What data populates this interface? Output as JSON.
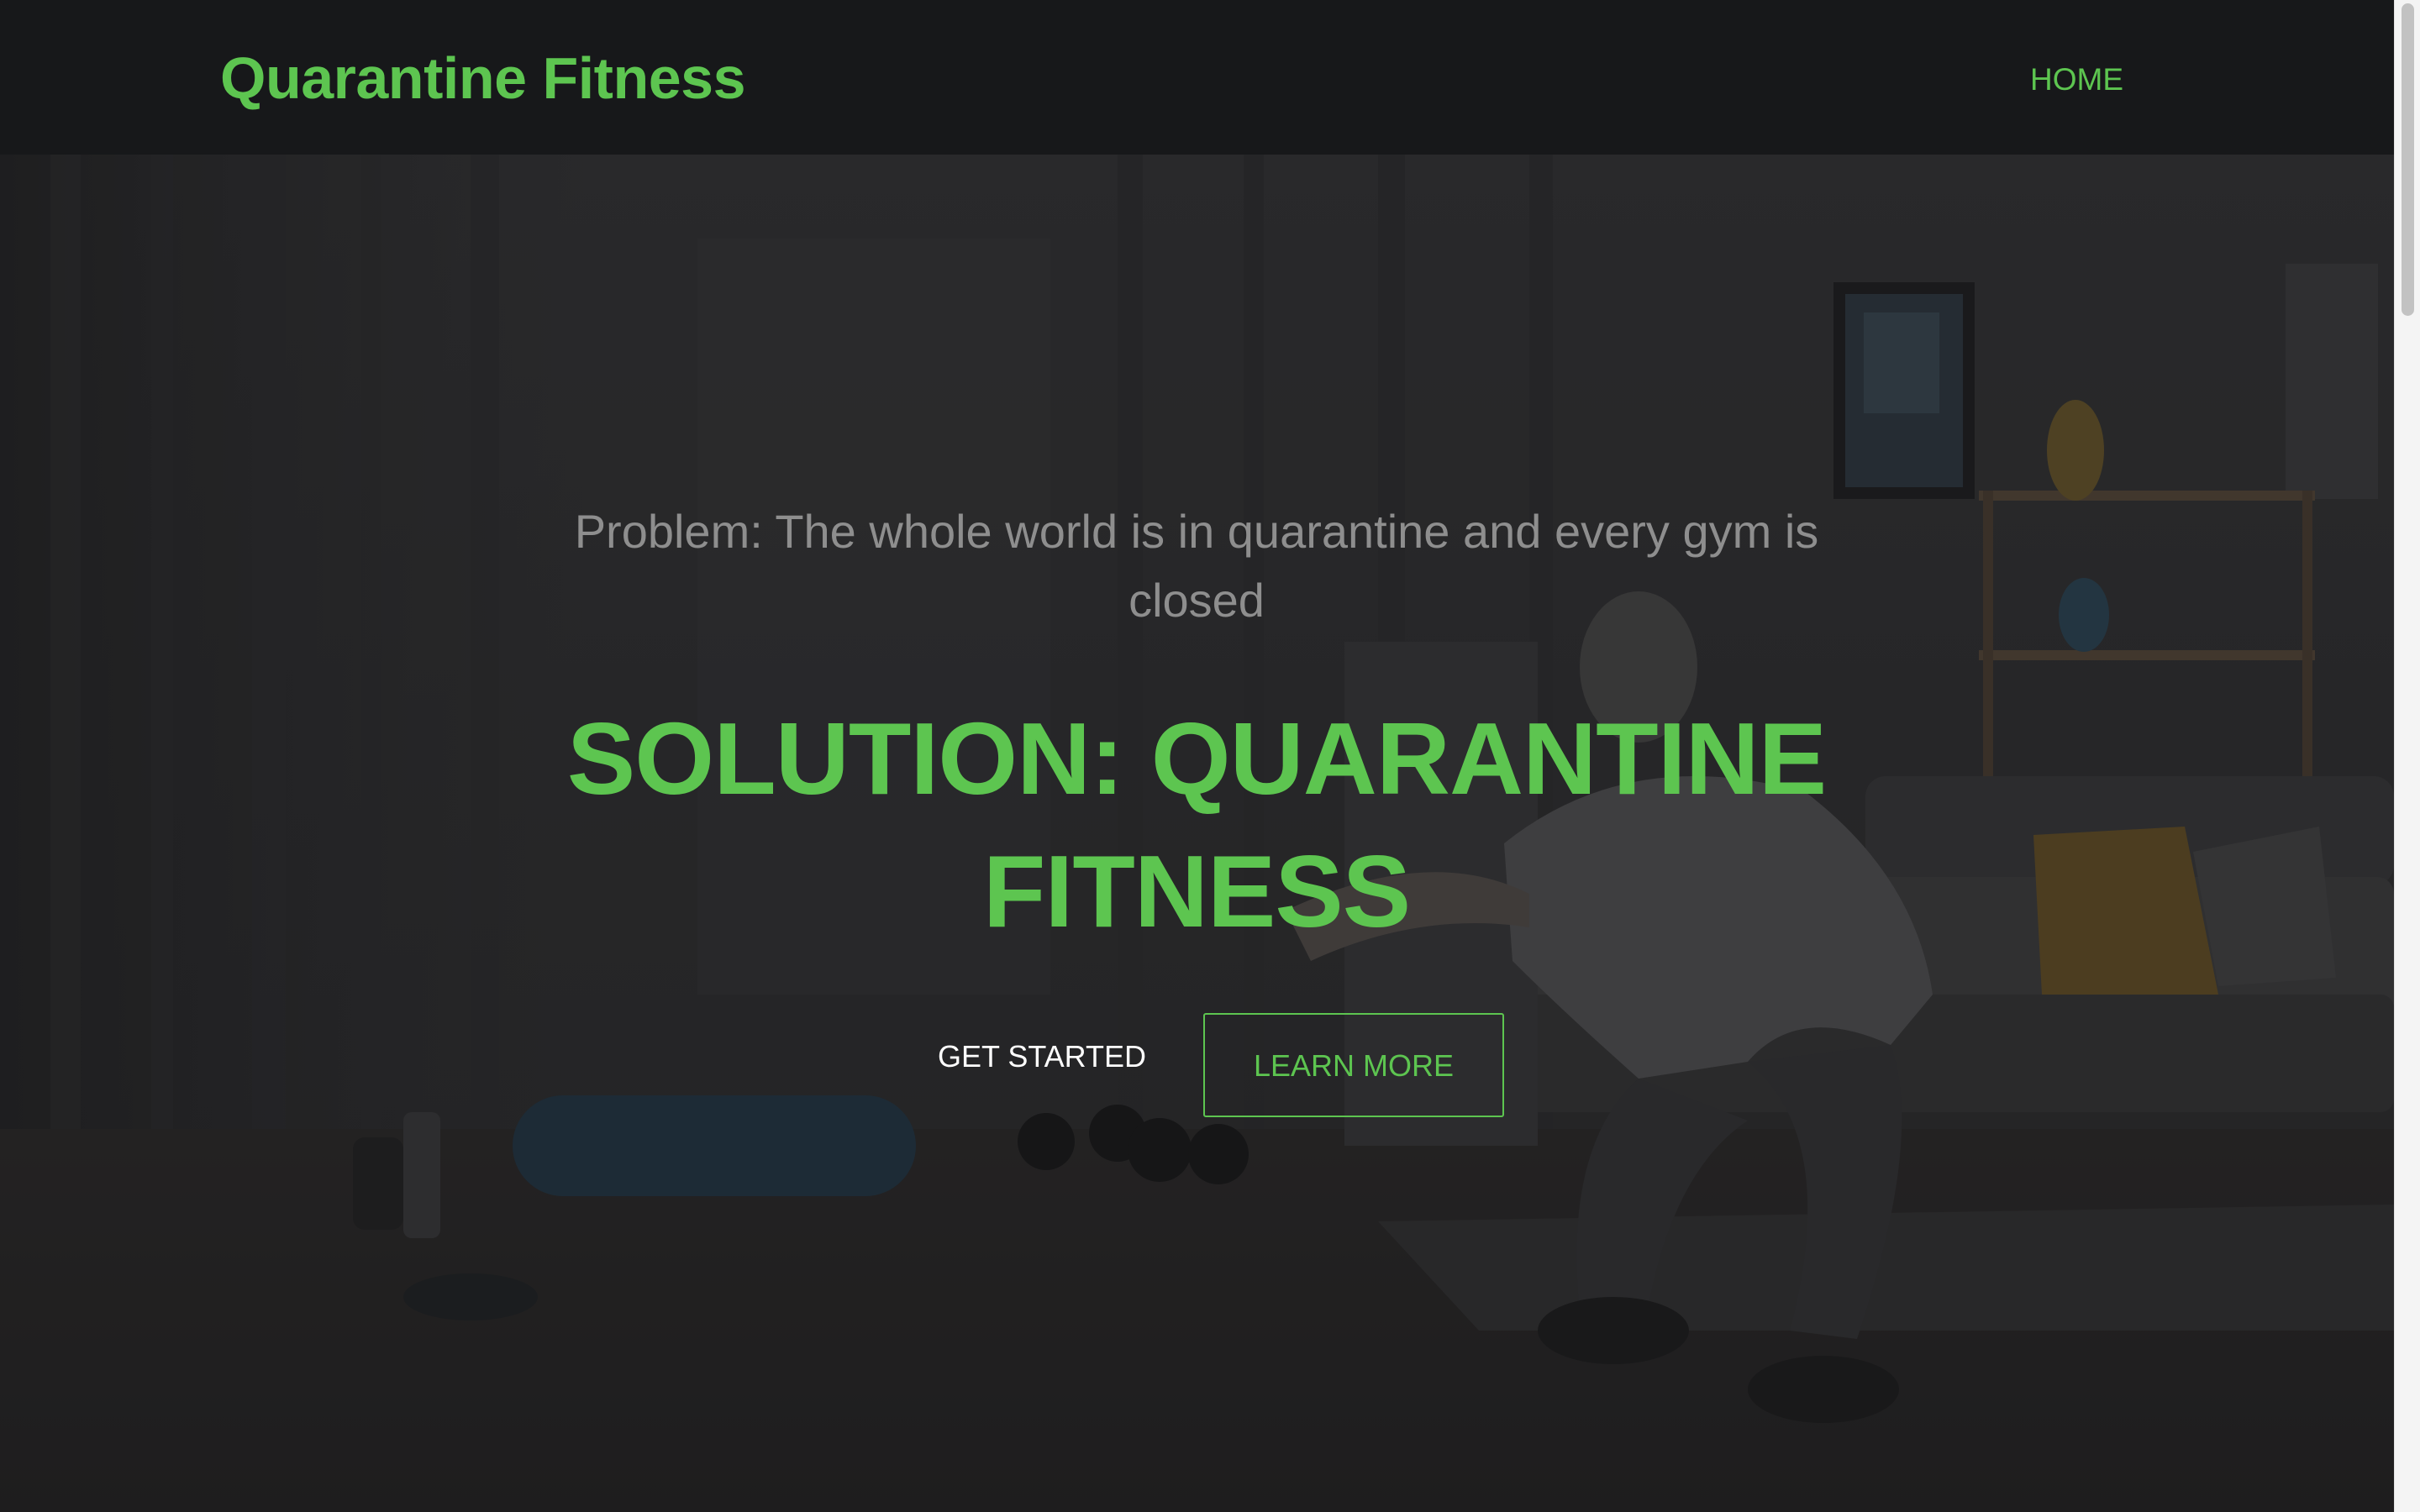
{
  "navbar": {
    "brand": "Quarantine Fitness",
    "links": [
      {
        "label": "HOME"
      }
    ]
  },
  "hero": {
    "problem_text": "Problem: The whole world is in quarantine and every gym is closed",
    "solution_heading": "SOLUTION: QUARANTINE FITNESS",
    "buttons": {
      "get_started": "GET STARTED",
      "learn_more": "LEARN MORE"
    }
  },
  "colors": {
    "accent": "#5dc550",
    "navbar_bg": "#17181a",
    "problem_text": "#8e8e8e",
    "button_text": "#ffffff"
  },
  "icons": []
}
